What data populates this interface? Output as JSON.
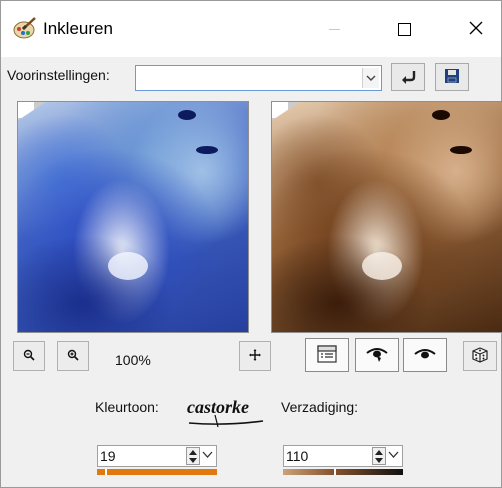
{
  "window": {
    "title": "Inkleuren",
    "icon": "brush-palette-icon",
    "controls": {
      "minimize": "minimize-icon",
      "maximize": "maximize-icon",
      "close": "close-icon"
    }
  },
  "presets": {
    "label": "Voorinstellingen:",
    "value": "",
    "icons": {
      "dropdown": "chevron-down-icon",
      "reset": "undo-arrow-icon",
      "save": "save-disk-icon"
    }
  },
  "previews": {
    "original": "original-preview",
    "result": "result-preview",
    "colors": {
      "original_accent": "#2b49c2",
      "result_accent": "#6a3a18"
    }
  },
  "zoom": {
    "level_label": "100%",
    "icons": {
      "zoom_out": "zoom-out-icon",
      "zoom_in": "zoom-in-icon",
      "pan": "move-icon"
    }
  },
  "modes": {
    "icons": {
      "layout": "layout-icon",
      "preview": "eye-preview-icon",
      "auto_proof": "eye-icon",
      "randomize": "dice-icon"
    }
  },
  "controls": {
    "hue": {
      "label": "Kleurtoon:",
      "value": "19",
      "accent": "#e07a10",
      "level": 0.07
    },
    "saturation": {
      "label": "Verzadiging:",
      "value": "110",
      "accent": "#8a5530",
      "level": 0.43
    },
    "logo_text": "castorke"
  }
}
